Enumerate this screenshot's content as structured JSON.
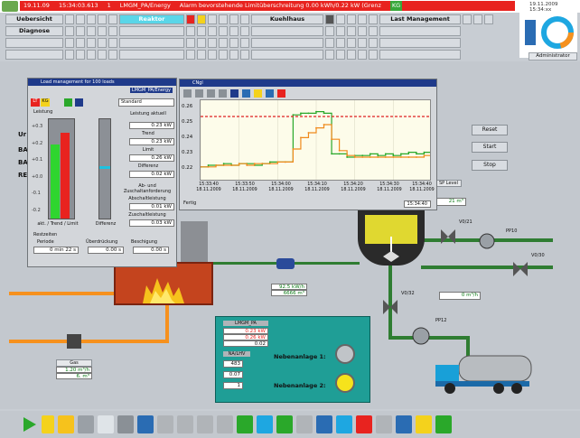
{
  "top": {
    "date": "19.11.09",
    "time": "15:34:03.613",
    "alarm_no": "1",
    "source": "LMGM_PA/Energy",
    "alarm_text": "Alarm bevorstehende Limitüberschreitung 0.00 kWh/0.22 kW (Grenz",
    "alarm_tag": "KG",
    "datetime_right": "19.11.2009 15:34:xx"
  },
  "nav": {
    "row1": [
      "Uebersicht",
      "Reaktor",
      "Kuehlhaus",
      "Last Management"
    ],
    "row2": [
      "Diagnose"
    ],
    "admin": "Administrator"
  },
  "load_panel": {
    "title": "Load management for 100 loads",
    "subtitle": "LMGM_PA/Energy",
    "mode": "Standard",
    "section_leistung": "Leistung",
    "scale": [
      "+0.3",
      "+0.2",
      "+0.1",
      "+0.0",
      "-0.1",
      "-0.2",
      "-0.3"
    ],
    "bar_label_left": "akt. / Trend / Limit",
    "bar_label_right": "Differenz",
    "fields": [
      {
        "label": "Leistung aktuell",
        "value": "0.23",
        "unit": "kW"
      },
      {
        "label": "Trend",
        "value": "0.23",
        "unit": "kW"
      },
      {
        "label": "Limit",
        "value": "0.26",
        "unit": "kW"
      },
      {
        "label": "Differenz",
        "value": "0.02",
        "unit": "kW"
      }
    ],
    "ab_header": "Ab- und Zuschaltanforderung",
    "ab_fields": [
      {
        "label": "Abschaltleistung",
        "value": "0.01",
        "unit": "kW"
      },
      {
        "label": "Zuschaltleistung",
        "value": "0.03",
        "unit": "kW"
      }
    ],
    "rest_header": "Restzeiten",
    "periode_label": "Periode",
    "periode_value": "0 min 22 s",
    "ueber_label": "Überdrückung",
    "ueber_value": "0.00 s",
    "besch_label": "Beschigung",
    "besch_value": "0.00 s",
    "status_red": "LT",
    "status_yellow": "KG"
  },
  "chart_window": {
    "title": "CNgl",
    "footer_left": "Fertig",
    "footer_right": "15:34:40"
  },
  "chart_data": {
    "type": "line",
    "title": "",
    "xlabel": "",
    "ylabel": "",
    "ylim": [
      0.21,
      0.26
    ],
    "y_ticks": [
      "0.26",
      "0.25",
      "0.24",
      "0.23",
      "0.22"
    ],
    "x_ticks": [
      {
        "time": "15:33:40",
        "date": "18.11.2009"
      },
      {
        "time": "15:33:50",
        "date": "18.11.2009"
      },
      {
        "time": "15:34:00",
        "date": "18.11.2009"
      },
      {
        "time": "15:34:10",
        "date": "18.11.2009"
      },
      {
        "time": "15:34:20",
        "date": "18.11.2009"
      },
      {
        "time": "15:34:30",
        "date": "18.11.2009"
      },
      {
        "time": "15:34:40",
        "date": "18.11.2009"
      }
    ],
    "x": [
      0,
      2,
      4,
      6,
      8,
      10,
      12,
      14,
      16,
      18,
      20,
      22,
      24,
      26,
      28,
      30,
      32,
      34,
      36,
      38,
      40,
      42,
      44,
      46,
      48,
      50,
      52,
      54,
      56,
      58,
      60
    ],
    "series": [
      {
        "name": "",
        "color": "#2aa82a",
        "values": [
          0.219,
          0.22,
          0.22,
          0.221,
          0.22,
          0.221,
          0.221,
          0.22,
          0.221,
          0.222,
          0.222,
          0.222,
          0.251,
          0.252,
          0.252,
          0.253,
          0.252,
          0.227,
          0.227,
          0.225,
          0.226,
          0.226,
          0.227,
          0.226,
          0.227,
          0.226,
          0.227,
          0.228,
          0.227,
          0.228,
          0.23
        ]
      },
      {
        "name": "",
        "color": "#f08a1c",
        "values": [
          0.219,
          0.219,
          0.22,
          0.22,
          0.22,
          0.221,
          0.22,
          0.221,
          0.221,
          0.221,
          0.222,
          0.222,
          0.23,
          0.237,
          0.24,
          0.243,
          0.245,
          0.236,
          0.229,
          0.226,
          0.225,
          0.225,
          0.225,
          0.225,
          0.225,
          0.225,
          0.225,
          0.225,
          0.225,
          0.226,
          0.226
        ]
      },
      {
        "name": "",
        "color": "#e02020",
        "dashed": true,
        "values": [
          0.25,
          0.25,
          0.25,
          0.25,
          0.25,
          0.25,
          0.25,
          0.25,
          0.25,
          0.25,
          0.25,
          0.25,
          0.25,
          0.25,
          0.25,
          0.25,
          0.25,
          0.25,
          0.25,
          0.25,
          0.25,
          0.25,
          0.25,
          0.25,
          0.25,
          0.25,
          0.25,
          0.25,
          0.25,
          0.25,
          0.25
        ]
      }
    ]
  },
  "plant": {
    "buttons": [
      "Reset",
      "Start",
      "Stop"
    ],
    "level_label": "SP Level",
    "level_value": "21 m³",
    "meter_value_1": "92.5 kW/h",
    "meter_value_2": "6666 m³",
    "gas_label": "Gas",
    "gas_value_1": "1.20 m³/h",
    "gas_value_2": "6. m³",
    "flow_right": "0 m³/h",
    "valve_tags": [
      "V0/21",
      "PP10",
      "V0/30",
      "V0/32",
      "PP12"
    ],
    "teal": {
      "title": "LMGM_PA",
      "val1": "0.23 kW",
      "val2": "0.26 kW",
      "val3": "0.02",
      "label_small": "NA/LHV",
      "num1": "483",
      "num2": "0.07",
      "num3": "1",
      "nb1": "Nebenanlage 1:",
      "nb2": "Nebenanlage 2:"
    },
    "left_labels": [
      "Ur",
      "BA",
      "BA",
      "RE"
    ]
  }
}
